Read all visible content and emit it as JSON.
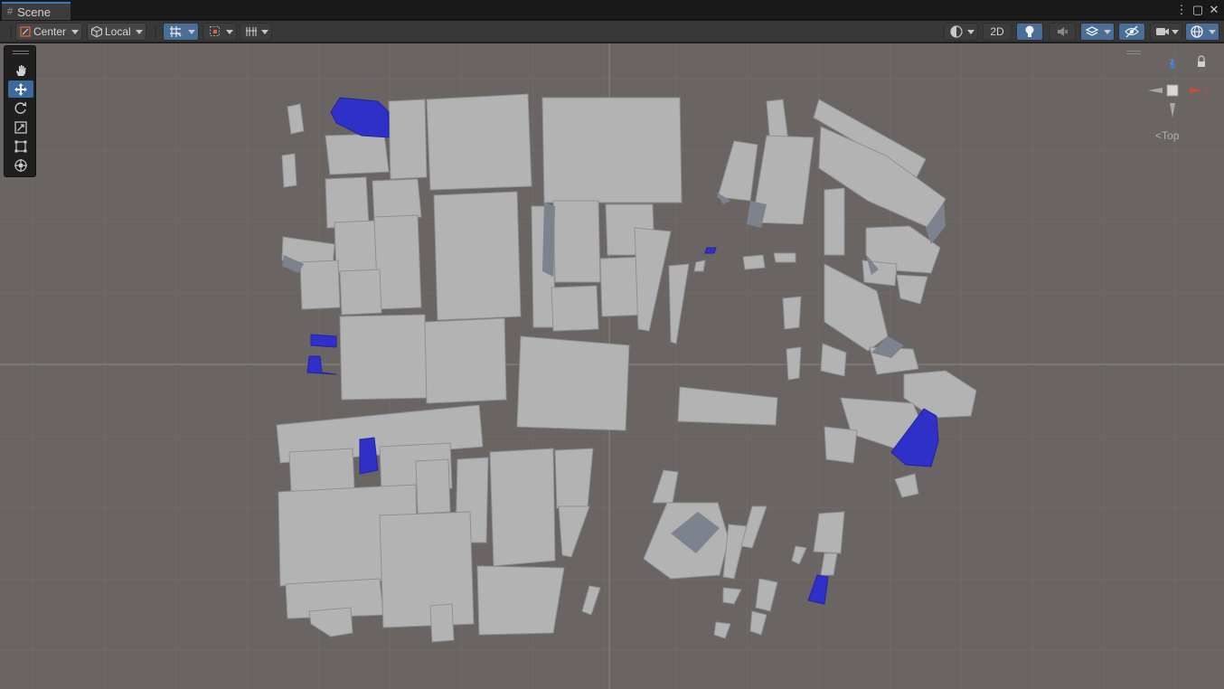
{
  "window": {
    "tab_title": "Scene"
  },
  "window_controls": {
    "menu": "⋮",
    "maximize": "▢",
    "close": "✕"
  },
  "toolbar": {
    "pivot_mode": "Center",
    "pivot_rotation": "Local",
    "mode_2d": "2D"
  },
  "tools": [
    {
      "name": "view-tool",
      "selected": false
    },
    {
      "name": "move-tool",
      "selected": true
    },
    {
      "name": "rotate-tool",
      "selected": false
    },
    {
      "name": "scale-tool",
      "selected": false
    },
    {
      "name": "rect-tool",
      "selected": false
    },
    {
      "name": "transform-tool",
      "selected": false
    }
  ],
  "gizmo": {
    "view_label": "Top",
    "axis_x": "x",
    "axis_z": "z"
  },
  "colors": {
    "viewport_bg": "#6a6562",
    "building": "#b4b4b4",
    "building_shadow": "#7f8590",
    "highlight": "#2e30c8",
    "accent": "#3a79bb"
  }
}
